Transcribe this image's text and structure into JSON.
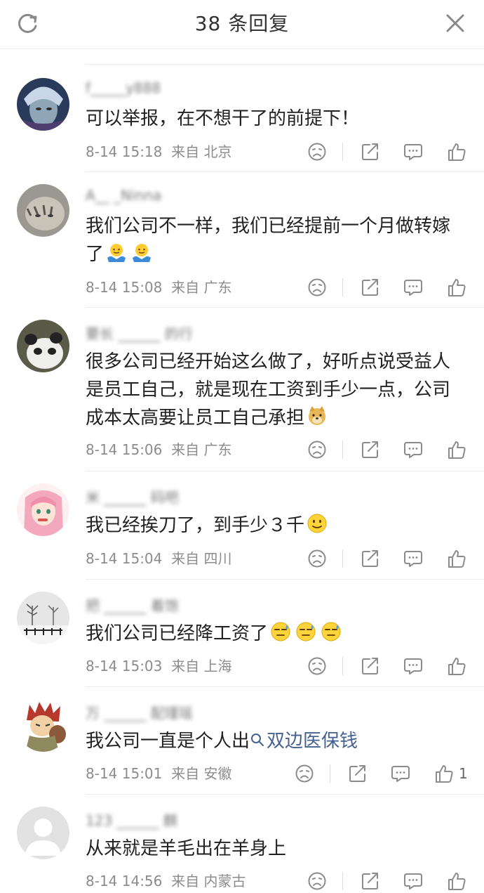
{
  "header": {
    "title": "38 条回复",
    "refresh_icon": "refresh-icon",
    "close_icon": "close-icon"
  },
  "comments": [
    {
      "username": "f_____y888",
      "text": "可以举报，在不想干了的前提下！",
      "date": "8-14 15:18",
      "from": "来自 北京",
      "likes": ""
    },
    {
      "username": "A__ _Ninna",
      "text": "我们公司不一样，我们已经提前一个月做转嫁了",
      "emoji": "shrug-emoji",
      "date": "8-14 15:08",
      "from": "来自 广东",
      "likes": ""
    },
    {
      "username": "要长 ______ 的行",
      "text": "很多公司已经开始这么做了，好听点说受益人是员工自己，就是现在工资到手少一点，公司成本太高要让员工自己承担",
      "emoji": "doge-emoji",
      "date": "8-14 15:06",
      "from": "来自 广东",
      "likes": ""
    },
    {
      "username": "米 ______ 码吧",
      "text": "我已经挨刀了，到手少３千",
      "emoji": "smile-emoji",
      "date": "8-14 15:04",
      "from": "来自 四川",
      "likes": ""
    },
    {
      "username": "把 ______ 着饱",
      "text": "我们公司已经降工资了",
      "emoji": "sweat-emoji",
      "date": "8-14 15:03",
      "from": "来自 上海",
      "likes": ""
    },
    {
      "username": "万 ______ 配瑾瑶",
      "text_prefix": "我公司一直是个人出",
      "link_text": "双边医保钱",
      "date": "8-14 15:01",
      "from": "来自 安徽",
      "likes": "1"
    },
    {
      "username": "123 ______ 麒",
      "text": "从来就是羊毛出在羊身上",
      "date": "8-14 14:56",
      "from": "来自 内蒙古",
      "likes": ""
    }
  ],
  "colors": {
    "link": "#45618f",
    "meta": "#8c8c8c",
    "text": "#222222"
  }
}
